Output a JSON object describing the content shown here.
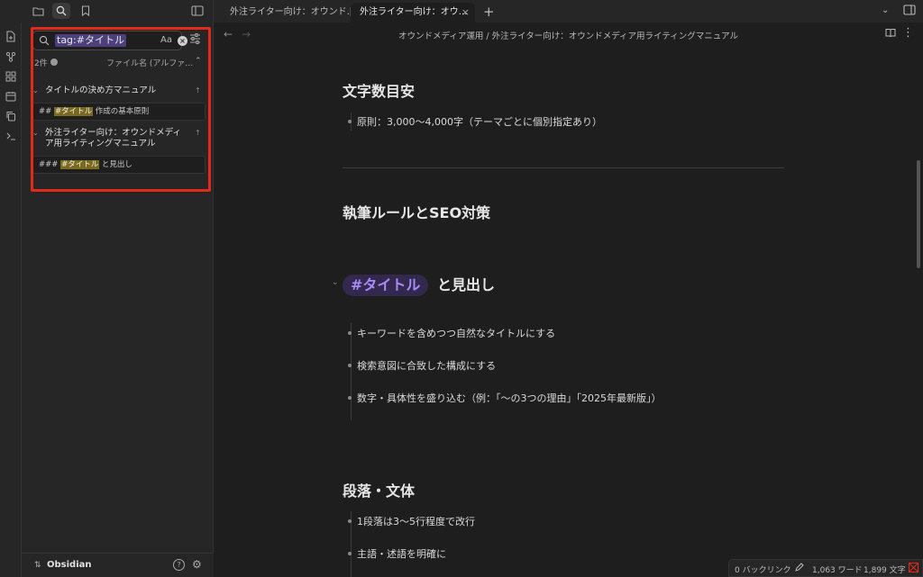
{
  "header": {
    "icons": [
      "folder-icon",
      "search-icon",
      "bookmark-icon",
      "sidebar-toggle-icon"
    ]
  },
  "tabs": [
    {
      "label": "外注ライター向け：オウンド…",
      "active": false
    },
    {
      "label": "外注ライター向け：オウ…",
      "active": true,
      "close": "×"
    }
  ],
  "new_tab": "+",
  "search": {
    "query": "tag:#タイトル",
    "match_case": "Aa",
    "clear": "×",
    "count": "2件",
    "sort": "ファイル名 (アルファ…",
    "sort_chevron": "⌃"
  },
  "results": [
    {
      "file": "タイトルの決め方マニュアル",
      "matches": [
        {
          "prefix": "## ",
          "tag": "#タイトル",
          "suffix": " 作成の基本原則"
        }
      ]
    },
    {
      "file": "外注ライター向け：オウンドメディア用ライティングマニュアル",
      "matches": [
        {
          "prefix": "### ",
          "tag": "#タイトル",
          "suffix": " と見出し"
        }
      ]
    }
  ],
  "vault": {
    "name": "Obsidian",
    "help": "?"
  },
  "breadcrumb": "オウンドメディア運用 / 外注ライター向け：オウンドメディア用ライティングマニュアル",
  "document": {
    "sections": [
      {
        "heading": "文字数目安",
        "items": [
          "原則：3,000〜4,000字（テーマごとに個別指定あり）"
        ]
      },
      {
        "heading": "執筆ルールとSEO対策",
        "items": []
      },
      {
        "heading_tag": "#タイトル",
        "heading_suffix": "と見出し",
        "items": [
          "キーワードを含めつつ自然なタイトルにする",
          "検索意図に合致した構成にする",
          "数字・具体性を盛り込む（例：「〜の3つの理由」「2025年最新版」）"
        ]
      },
      {
        "heading": "段落・文体",
        "items": [
          "1段落は3〜5行程度で改行",
          "主語・述語を明確に"
        ]
      }
    ]
  },
  "status": {
    "backlinks": "0 バックリンク",
    "words": "1,063 ワード",
    "chars": "1,899 文字"
  },
  "colors": {
    "accent": "#a78bfa",
    "highlight": "#7b6a1e",
    "annotation_box": "#e3291b"
  }
}
